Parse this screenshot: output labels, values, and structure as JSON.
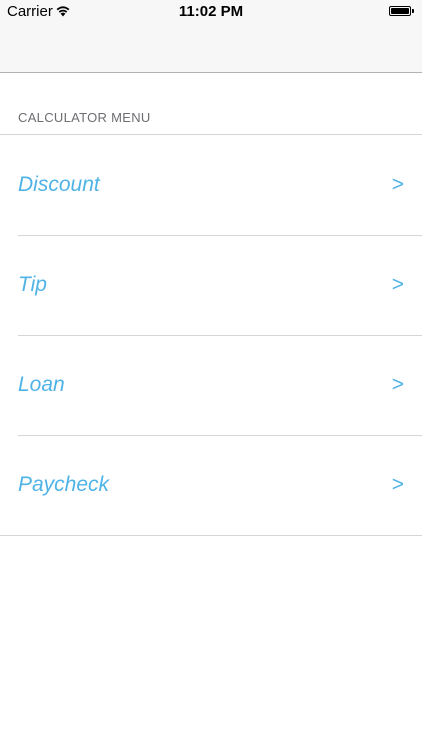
{
  "status_bar": {
    "carrier": "Carrier",
    "time": "11:02 PM"
  },
  "section": {
    "header": "CALCULATOR MENU"
  },
  "menu": {
    "items": [
      {
        "label": "Discount",
        "chevron": ">"
      },
      {
        "label": "Tip",
        "chevron": ">"
      },
      {
        "label": "Loan",
        "chevron": ">"
      },
      {
        "label": "Paycheck",
        "chevron": ">"
      }
    ]
  },
  "colors": {
    "accent": "#4fb3e6",
    "section_header": "#6d6d72",
    "separator": "#d6d6d6",
    "nav_background": "#f7f7f7"
  },
  "icons": {
    "wifi": "wifi-icon",
    "battery": "battery-icon",
    "chevron": "chevron-right-icon"
  }
}
